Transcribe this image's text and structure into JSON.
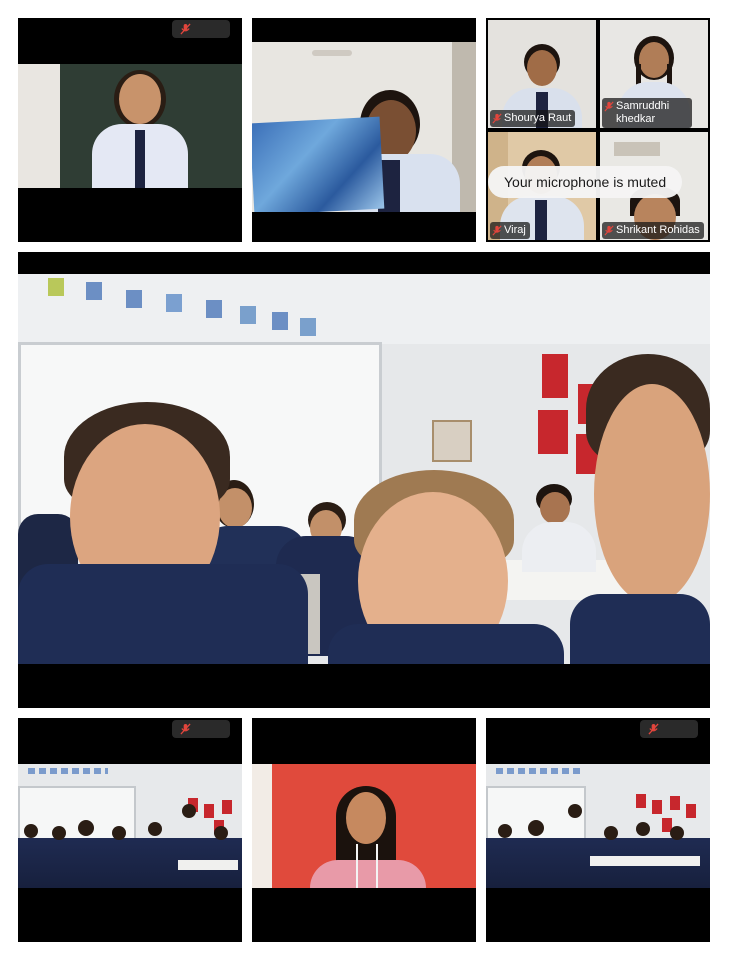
{
  "app": {
    "type": "video-conference-gallery"
  },
  "toast": {
    "text": "Your microphone is muted"
  },
  "participants": [
    {
      "name": "Shourya Raut",
      "muted": true
    },
    {
      "name": "Samruddhi khedkar",
      "muted": true
    },
    {
      "name": "Viraj",
      "muted": true
    },
    {
      "name": "Shrikant Rohidas",
      "muted": true
    }
  ],
  "icons": {
    "mic": "mic-muted-icon"
  },
  "colors": {
    "muted_icon": "#e2453c",
    "name_tag_bg": "#141414",
    "tile_bg": "#000000",
    "toast_bg": "#f5f5f5"
  }
}
